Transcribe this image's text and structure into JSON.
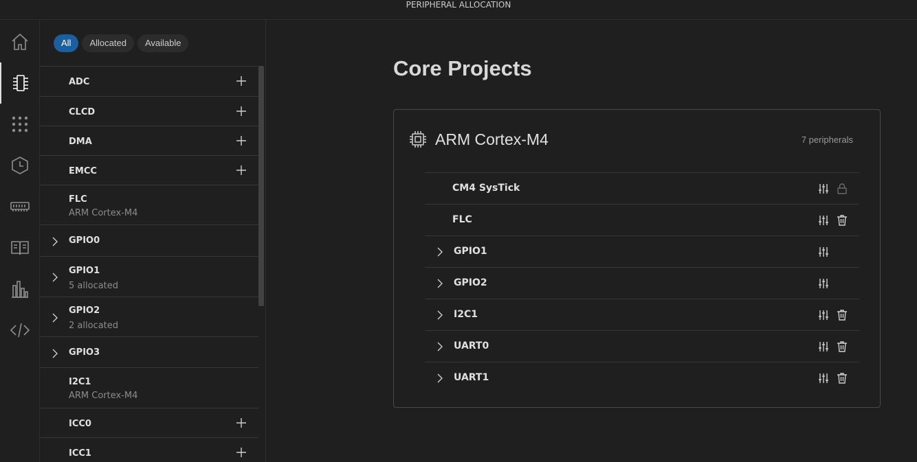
{
  "titlebar": {
    "title": "PERIPHERAL ALLOCATION"
  },
  "activity_bar": {
    "icons": [
      "home-icon",
      "chip-pins-icon",
      "dot-grid-icon",
      "clock-icon",
      "memory-icon",
      "book-icon",
      "bar-chart-icon",
      "code-icon"
    ],
    "active": "chip-pins-icon"
  },
  "filters": {
    "all": "All",
    "allocated": "Allocated",
    "available": "Available",
    "active": "All",
    "active_color": "#1d5f9e"
  },
  "peripherals": [
    {
      "name": "ADC",
      "sub": "",
      "action": "add",
      "expandable": false
    },
    {
      "name": "CLCD",
      "sub": "",
      "action": "add",
      "expandable": false
    },
    {
      "name": "DMA",
      "sub": "",
      "action": "add",
      "expandable": false
    },
    {
      "name": "EMCC",
      "sub": "",
      "action": "add",
      "expandable": false
    },
    {
      "name": "FLC",
      "sub": "ARM Cortex-M4",
      "action": "",
      "expandable": false
    },
    {
      "name": "GPIO0",
      "sub": "",
      "action": "",
      "expandable": true
    },
    {
      "name": "GPIO1",
      "sub": "5 allocated",
      "action": "",
      "expandable": true
    },
    {
      "name": "GPIO2",
      "sub": "2 allocated",
      "action": "",
      "expandable": true
    },
    {
      "name": "GPIO3",
      "sub": "",
      "action": "",
      "expandable": true
    },
    {
      "name": "I2C1",
      "sub": "ARM Cortex-M4",
      "action": "",
      "expandable": false
    },
    {
      "name": "ICC0",
      "sub": "",
      "action": "add",
      "expandable": false
    },
    {
      "name": "ICC1",
      "sub": "",
      "action": "add",
      "expandable": false
    }
  ],
  "main": {
    "title": "Core Projects",
    "core": {
      "name": "ARM Cortex-M4",
      "count_label": "7 peripherals",
      "allocations": [
        {
          "name": "CM4 SysTick",
          "expandable": false,
          "actions": [
            "sliders-icon",
            "lock-icon"
          ]
        },
        {
          "name": "FLC",
          "expandable": false,
          "actions": [
            "sliders-icon",
            "trash-icon"
          ]
        },
        {
          "name": "GPIO1",
          "expandable": true,
          "actions": [
            "sliders-icon"
          ]
        },
        {
          "name": "GPIO2",
          "expandable": true,
          "actions": [
            "sliders-icon"
          ]
        },
        {
          "name": "I2C1",
          "expandable": true,
          "actions": [
            "sliders-icon",
            "trash-icon"
          ]
        },
        {
          "name": "UART0",
          "expandable": true,
          "actions": [
            "sliders-icon",
            "trash-icon"
          ]
        },
        {
          "name": "UART1",
          "expandable": true,
          "actions": [
            "sliders-icon",
            "trash-icon"
          ]
        }
      ]
    }
  }
}
